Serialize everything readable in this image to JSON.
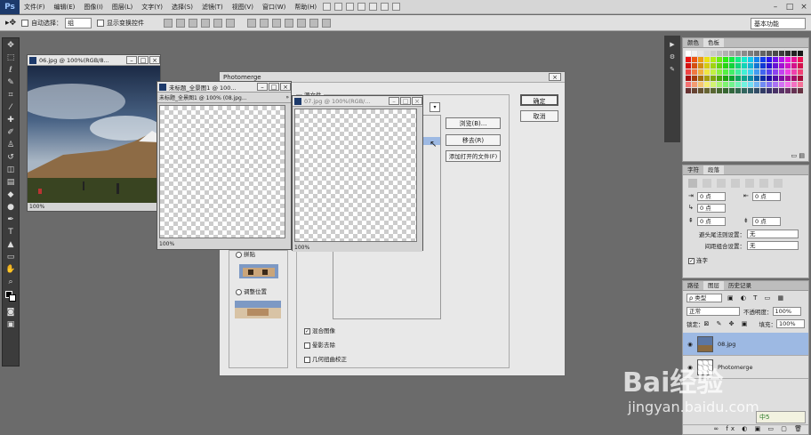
{
  "app": {
    "logo": "Ps",
    "workspace": "基本功能"
  },
  "menu": [
    "文件(F)",
    "编辑(E)",
    "图像(I)",
    "图层(L)",
    "文字(Y)",
    "选择(S)",
    "滤镜(T)",
    "视图(V)",
    "窗口(W)",
    "帮助(H)"
  ],
  "window_controls": [
    "–",
    "□",
    "×"
  ],
  "options": {
    "auto_select": "自动选择：",
    "auto_select_value": "组",
    "show_transform": "显示变换控件"
  },
  "doc1": {
    "title": "06.jpg @ 100%(RGB/8...",
    "zoom": "100%"
  },
  "doc2": {
    "title": "未标题_全景图1 @ 100...",
    "tab": "未标题_全景图1 @ 100% (08.jpg...",
    "zoom": "100%"
  },
  "doc3": {
    "title": "07.jpg @ 100%(RGB/...",
    "zoom": "100%"
  },
  "dialog": {
    "title": "Photomerge",
    "group_label": "源文件",
    "buttons": {
      "ok": "确定",
      "cancel": "取消",
      "browse": "浏览(B)...",
      "remove": "移去(R)",
      "add_open": "添加打开的文件(F)"
    },
    "layout_options": [
      "拼贴",
      "调整位置"
    ],
    "checkboxes": [
      {
        "label": "混合图像",
        "checked": true
      },
      {
        "label": "晕影去除",
        "checked": false
      },
      {
        "label": "几何扭曲校正",
        "checked": false
      }
    ]
  },
  "swatches_panel": {
    "tabs": [
      "颜色",
      "色板"
    ],
    "active": "色板"
  },
  "paragraph_panel": {
    "tabs": [
      "字符",
      "段落"
    ],
    "active": "段落",
    "indent_left": "0 点",
    "indent_right": "0 点",
    "indent_first": "0 点",
    "space_before": "0 点",
    "space_after": "0 点",
    "kinsoku_label": "避头尾法则设置：",
    "kinsoku_value": "无",
    "mojikumi_label": "间距组合设置：",
    "mojikumi_value": "无",
    "hyphenate_label": "连字"
  },
  "layers_panel": {
    "tabs": [
      "路径",
      "图层",
      "历史记录"
    ],
    "active": "图层",
    "filter_label": "ρ 类型",
    "blend_mode": "正常",
    "opacity_label": "不透明度：",
    "opacity": "100%",
    "lock_label": "锁定：",
    "fill_label": "填充：",
    "fill": "100%",
    "layers": [
      {
        "name": "08.jpg",
        "selected": true
      },
      {
        "name": "Photomerge",
        "selected": false
      }
    ]
  },
  "watermark": {
    "text": "Bai经验",
    "url": "jingyan.baidu.com",
    "badge": "中5"
  },
  "colors": {
    "bg": "#6b6b6b",
    "panel": "#dedede",
    "selected_layer": "#9db9e3",
    "ps_blue": "#1d3a6b"
  }
}
